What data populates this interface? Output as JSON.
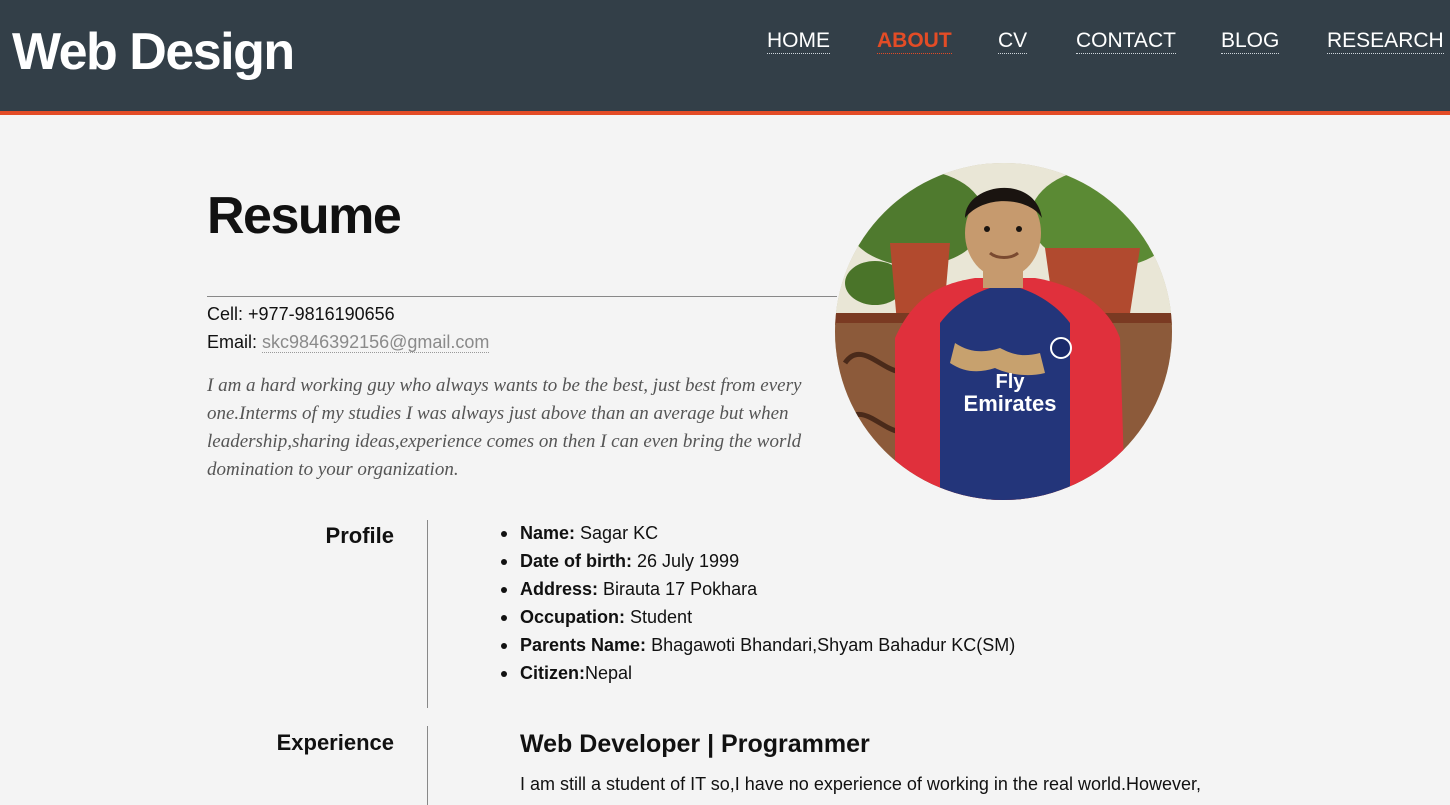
{
  "header": {
    "brand": "Web Design",
    "nav": [
      "HOME",
      "ABOUT",
      "CV",
      "CONTACT",
      "BLOG",
      "RESEARCH"
    ],
    "active_nav": "ABOUT"
  },
  "resume": {
    "title": "Resume",
    "cell_label": "Cell:",
    "cell_value": "+977-9816190656",
    "email_label": "Email:",
    "email_value": "skc9846392156@gmail.com",
    "bio": "I am a hard working guy who always wants to be the best, just best from every one.Interms of my studies I was always just above than an average but when leadership,sharing ideas,experience comes on then I can even bring the world domination to your organization."
  },
  "profile": {
    "label": "Profile",
    "items": [
      {
        "key": "Name:",
        "value": "Sagar KC"
      },
      {
        "key": "Date of birth:",
        "value": "26 July 1999"
      },
      {
        "key": "Address:",
        "value": "Birauta 17 Pokhara"
      },
      {
        "key": "Occupation:",
        "value": "Student"
      },
      {
        "key": "Parents Name:",
        "value": "Bhagawoti Bhandari,Shyam Bahadur KC(SM)"
      },
      {
        "key": "Citizen:",
        "value": "Nepal"
      }
    ]
  },
  "experience": {
    "label": "Experience",
    "title": "Web Developer | Programmer",
    "text": "I am still a student of IT so,I have no experience of working in the real world.However,"
  },
  "colors": {
    "header_bg": "#333f48",
    "accent": "#e34c26",
    "page_bg": "#f4f4f4"
  },
  "photo": {
    "logo_text_1": "Fly",
    "logo_text_2": "Emirates"
  }
}
